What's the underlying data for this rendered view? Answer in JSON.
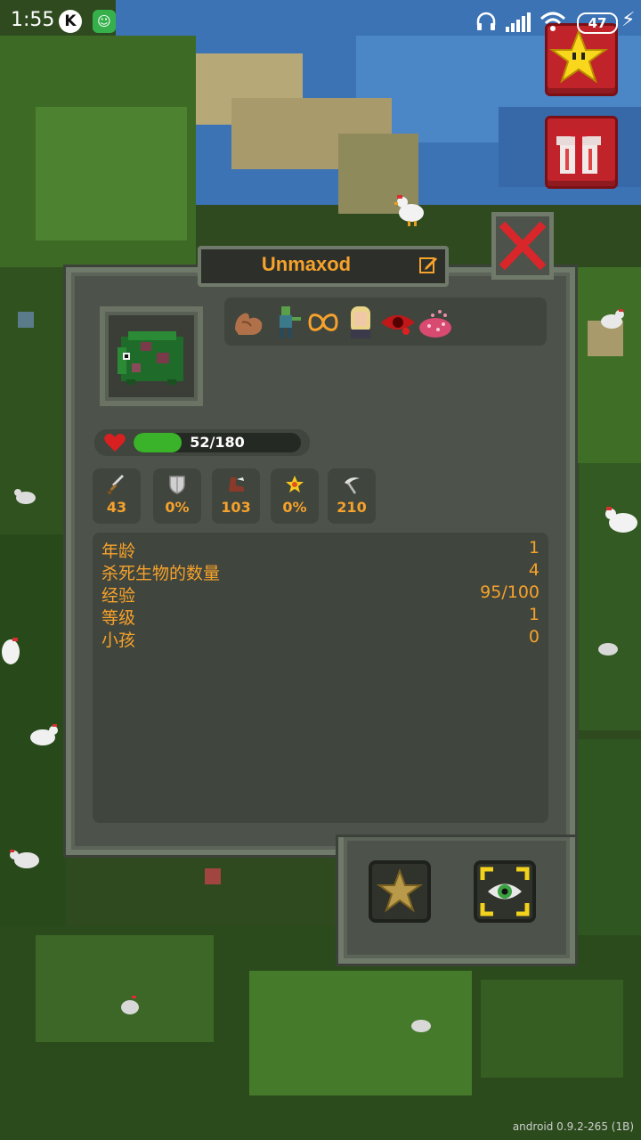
{
  "status_bar": {
    "time": "1:55",
    "icon_k": "K",
    "app_icon": "android-icon",
    "battery": "47"
  },
  "side_buttons": [
    {
      "icon": "star-icon"
    },
    {
      "icon": "gift-icon"
    }
  ],
  "creature": {
    "name": "Unmaxod",
    "avatar": "green-frog-creature",
    "traits": [
      "strong-arm-icon",
      "zombie-icon",
      "infinity-icon",
      "blonde-woman-icon",
      "red-eye-icon",
      "pink-mushroom-icon"
    ],
    "health": {
      "text": "52/180",
      "fraction": 0.289
    },
    "stats": [
      {
        "icon": "sword-icon",
        "value": "43"
      },
      {
        "icon": "shield-icon",
        "value": "0%"
      },
      {
        "icon": "boot-icon",
        "value": "103"
      },
      {
        "icon": "crit-star-icon",
        "value": "0%"
      },
      {
        "icon": "scythe-icon",
        "value": "210"
      }
    ],
    "info": [
      {
        "label": "年龄",
        "value": "1"
      },
      {
        "label": "杀死生物的数量",
        "value": "4"
      },
      {
        "label": "经验",
        "value": "95/100"
      },
      {
        "label": "等级",
        "value": "1"
      },
      {
        "label": "小孩",
        "value": "0"
      }
    ]
  },
  "colors": {
    "accent": "#f6a22c",
    "health": "#3ab22a",
    "close": "#d8262a"
  },
  "version": "android 0.9.2-265 (1B)"
}
